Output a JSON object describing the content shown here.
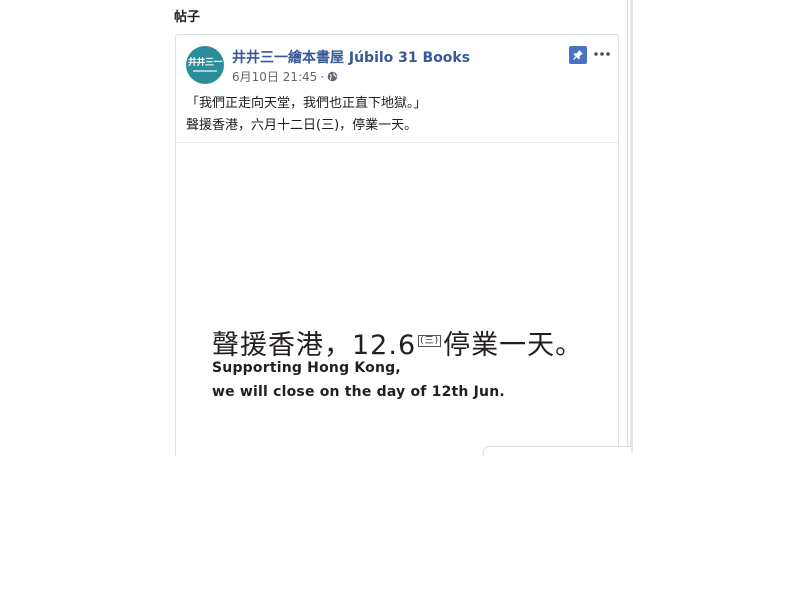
{
  "section": {
    "title": "帖子"
  },
  "post": {
    "page_name": "井井三一繪本書屋 Júbilo 31 Books",
    "date": "6月10日 21:45",
    "separator": "·",
    "avatar_text": "井井三一",
    "text_line1": "「我們正走向天堂，我們也正直下地獄。」",
    "text_line2": "聲援香港，六月十二日(三)，停業一天。",
    "pin_icon": "pin-icon",
    "more_icon": "more-options-icon",
    "privacy_icon": "globe-icon"
  },
  "banner": {
    "cn_part1": "聲援香港，12.6",
    "cn_day": "(三)",
    "cn_part2": "停業一天。",
    "en_line1": "Supporting Hong Kong,",
    "en_line2": "we will close on the day of 12th Jun."
  },
  "colors": {
    "link": "#385898",
    "meta": "#606770",
    "avatar_bg": "#2a8d98",
    "pin_bg": "#4a72c4"
  }
}
